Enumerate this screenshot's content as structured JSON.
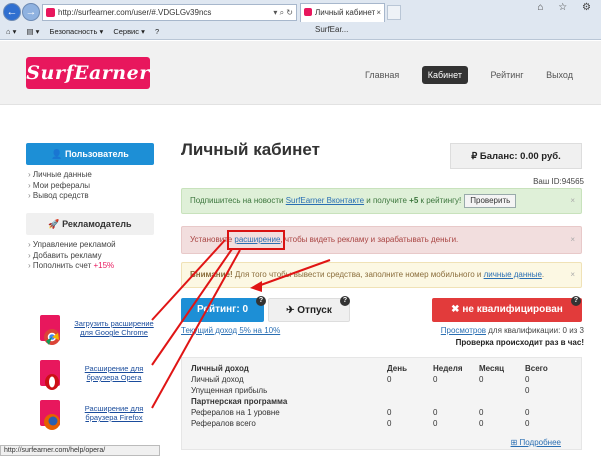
{
  "browser": {
    "url": "http://surfearner.com/user/#.VDGLGv39ncs",
    "tab_title": "Личный кабинет - SurfEar...",
    "tab_close": "×",
    "back_icon": "back-arrow-icon",
    "forward_icon": "forward-arrow-icon",
    "cmd": {
      "security": "Безопасность ▾",
      "service": "Сервис ▾",
      "help": "?"
    },
    "status_url": "http://surfearner.com/help/opera/"
  },
  "site": {
    "logo": "SurfEarner",
    "brand_color": "#e8175d",
    "nav": [
      "Главная",
      "Кабинет",
      "Рейтинг",
      "Выход"
    ]
  },
  "sidebar": {
    "user_button": "Пользователь",
    "user_items": [
      "Личные данные",
      "Мои рефералы",
      "Вывод средств"
    ],
    "advertiser_button": "Рекламодатель",
    "advertiser_items": [
      "Управление рекламой",
      "Добавить рекламу"
    ],
    "topup_label": "Пополнить счет",
    "topup_bonus": "+15%",
    "extensions": [
      {
        "label": "Загрузить расширение для Google Chrome",
        "icon": "chrome-extension-icon"
      },
      {
        "label": "Расширение для браузера Opera",
        "icon": "opera-extension-icon"
      },
      {
        "label": "Расширение для браузера Firefox",
        "icon": "firefox-extension-icon"
      }
    ]
  },
  "main": {
    "title": "Личный кабинет",
    "balance_label": "Баланс:",
    "balance_value": "0.00 руб.",
    "user_id": "Ваш ID:94565",
    "alert_vk": {
      "before": "Подпишитесь на новости ",
      "link": "SurfEarner Вконтакте",
      "middle": " и получите ",
      "bonus": "+5",
      "after": " к рейтингу!",
      "button": "Проверить"
    },
    "alert_install": {
      "before": "Установите ",
      "link": "расширение",
      "after": ", чтобы видеть рекламу и зарабатывать деньги."
    },
    "alert_attention": {
      "strong": "Внимание!",
      "text": " Для того чтобы вывести средства, заполните номер мобильного и ",
      "link": "личные данные",
      "end": "."
    },
    "rating_label": "Рейтинг: 0",
    "vacation_label": "Отпуск",
    "qualify_label": "не квалифицирован",
    "hourly_income": "Текущий доход 5% на 10%",
    "views_link": "Просмотров",
    "views_text": " для квалификации: 0 из 3",
    "daily_check": "Проверка происходит раз в час!",
    "income_table": {
      "headers": [
        "Личный доход",
        "День",
        "Неделя",
        "Месяц",
        "Всего"
      ],
      "rows": [
        {
          "label": "Личный доход",
          "vals": [
            "0",
            "0",
            "0",
            "0"
          ],
          "bold": false
        },
        {
          "label": "Упущенная прибыль",
          "vals": [
            "",
            "",
            "",
            "0"
          ],
          "bold": false
        },
        {
          "label": "Партнерская программа",
          "vals": [
            "",
            "",
            "",
            ""
          ],
          "bold": true
        },
        {
          "label": "Рефералов на 1 уровне",
          "vals": [
            "0",
            "0",
            "0",
            "0"
          ],
          "bold": false
        },
        {
          "label": "Рефералов всего",
          "vals": [
            "0",
            "0",
            "0",
            "0"
          ],
          "bold": false
        }
      ],
      "more": "Подробнее"
    }
  }
}
